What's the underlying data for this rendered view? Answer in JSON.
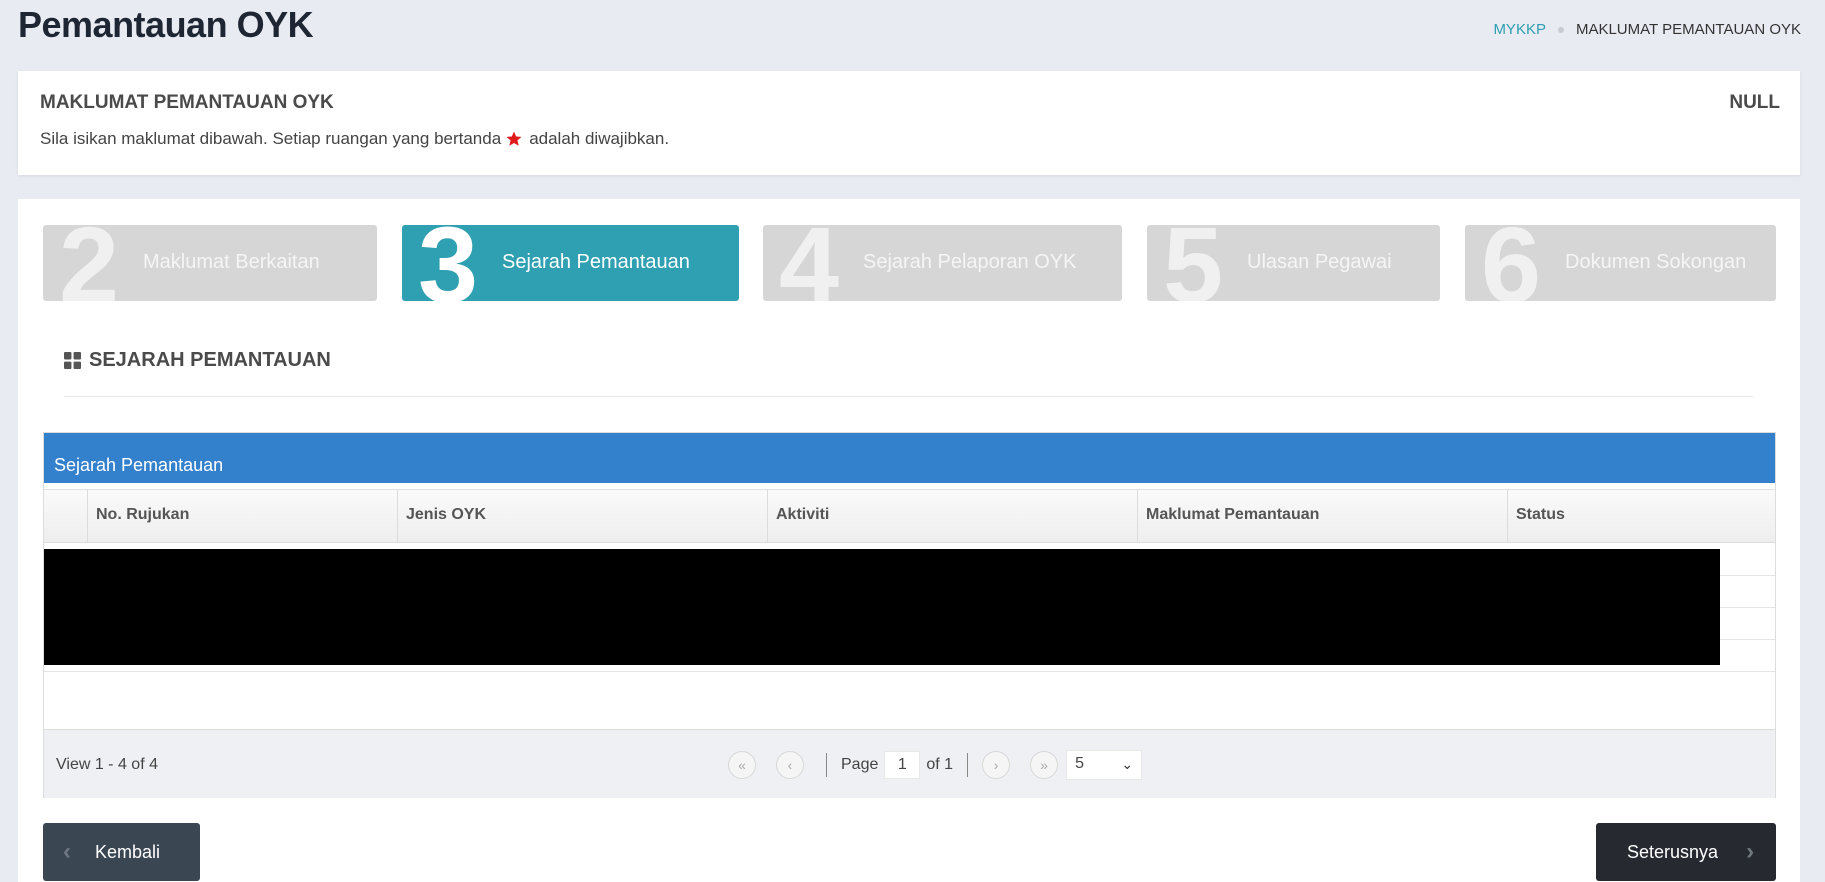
{
  "header": {
    "title": "Pemantauan OYK",
    "breadcrumb": {
      "home": "MYKKP",
      "current": "MAKLUMAT PEMANTAUAN OYK"
    }
  },
  "info_card": {
    "title": "MAKLUMAT PEMANTAUAN OYK",
    "status": "NULL",
    "desc_before": "Sila isikan maklumat dibawah. Setiap ruangan yang bertanda",
    "desc_after": "adalah diwajibkan.",
    "required_color": "#e0191c"
  },
  "steps": [
    {
      "num": "2",
      "label": "Maklumat Berkaitan",
      "active": false
    },
    {
      "num": "3",
      "label": "Sejarah Pemantauan",
      "active": true
    },
    {
      "num": "4",
      "label": "Sejarah Pelaporan OYK",
      "active": false
    },
    {
      "num": "5",
      "label": "Ulasan Pegawai",
      "active": false
    },
    {
      "num": "6",
      "label": "Dokumen Sokongan",
      "active": false
    }
  ],
  "section": {
    "icon": "grid-icon",
    "title": "SEJARAH PEMANTAUAN"
  },
  "grid": {
    "caption": "Sejarah Pemantauan",
    "columns": [
      "No. Rujukan",
      "Jenis OYK",
      "Aktiviti",
      "Maklumat Pemantauan",
      "Status"
    ],
    "rows_redacted": 4,
    "footer": {
      "view_text": "View 1 - 4 of 4",
      "page_label": "Page",
      "page_value": "1",
      "of_label": "of 1",
      "page_size": "5"
    }
  },
  "buttons": {
    "back": "Kembali",
    "next": "Seterusnya"
  },
  "colors": {
    "accent": "#2f9fb2",
    "grid_caption": "#3380cc",
    "link": "#2c9fb2"
  }
}
